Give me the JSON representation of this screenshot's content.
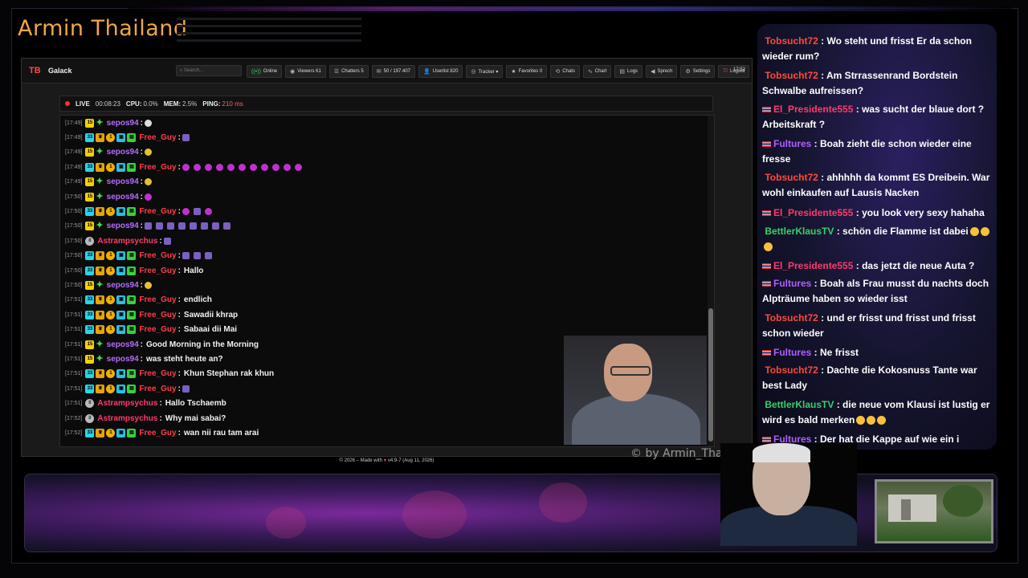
{
  "streamer_name": "Armin Thailand",
  "watermark": "© by Armin_Thailand",
  "app": {
    "logo": "TB",
    "name": "Galack",
    "search_placeholder": "Search...",
    "nav": [
      {
        "icon": "online-icon",
        "glyph": "((•))",
        "label": "Online",
        "cls": "online"
      },
      {
        "icon": "eye-icon",
        "glyph": "◉",
        "label": "Viewers  61"
      },
      {
        "icon": "chatters-icon",
        "glyph": "☰",
        "label": "Chatters  5"
      },
      {
        "icon": "message-icon",
        "glyph": "✉",
        "label": "50 / 197.407"
      },
      {
        "icon": "user-icon",
        "glyph": "👤",
        "label": "Userlist  820"
      },
      {
        "icon": "tracker-icon",
        "glyph": "◎",
        "label": "Tracker ▾"
      },
      {
        "icon": "star-icon",
        "glyph": "★",
        "label": "Favorites  0"
      },
      {
        "icon": "chats-icon",
        "glyph": "⟲",
        "label": "Chats"
      },
      {
        "icon": "chart-icon",
        "glyph": "∿",
        "label": "Chart"
      },
      {
        "icon": "logs-icon",
        "glyph": "▤",
        "label": "Logs"
      },
      {
        "icon": "speech-icon",
        "glyph": "◀",
        "label": "Sprech"
      },
      {
        "icon": "gear-icon",
        "glyph": "⚙",
        "label": "Settings"
      },
      {
        "icon": "logout-icon",
        "glyph": "⎋",
        "label": "Logout",
        "cls": "logout"
      }
    ],
    "clock": "17:52",
    "status": {
      "live_label": "LIVE",
      "live_time": "00:08:23",
      "cpu_label": "CPU:",
      "cpu_value": "0.0%",
      "mem_label": "MEM:",
      "mem_value": "2.5%",
      "ping_label": "PING:",
      "ping_value": "210 ms"
    },
    "footer_left": "© 2026 – Made with",
    "footer_right": "v4.9-7 (Aug 11, 2026)"
  },
  "chat_messages": [
    {
      "time": "[17:49]",
      "badges": [
        "15",
        "star"
      ],
      "user": "sepos94",
      "ucls": "u-sepos",
      "emotes": [
        "white"
      ],
      "text": ""
    },
    {
      "time": "[17:49]",
      "badges": [
        "33",
        "crown",
        "coin",
        "gift",
        "green"
      ],
      "user": "Free_Guy",
      "ucls": "u-free",
      "emotes": [
        "sq"
      ],
      "text": ""
    },
    {
      "time": "[17:49]",
      "badges": [
        "15",
        "star"
      ],
      "user": "sepos94",
      "ucls": "u-sepos",
      "emotes": [
        "yellow"
      ],
      "text": ""
    },
    {
      "time": "[17:49]",
      "badges": [
        "33",
        "crown",
        "coin",
        "gift",
        "green"
      ],
      "user": "Free_Guy",
      "ucls": "u-free",
      "emotes": [
        "e",
        "e",
        "e",
        "e",
        "e",
        "e",
        "e",
        "e",
        "e",
        "e",
        "e"
      ],
      "text": ""
    },
    {
      "time": "[17:49]",
      "badges": [
        "15",
        "star"
      ],
      "user": "sepos94",
      "ucls": "u-sepos",
      "emotes": [
        "yellow"
      ],
      "text": ""
    },
    {
      "time": "[17:50]",
      "badges": [
        "15",
        "star"
      ],
      "user": "sepos94",
      "ucls": "u-sepos",
      "emotes": [
        "e"
      ],
      "text": ""
    },
    {
      "time": "[17:50]",
      "badges": [
        "33",
        "crown",
        "coin",
        "gift",
        "green"
      ],
      "user": "Free_Guy",
      "ucls": "u-free",
      "emotes": [
        "e",
        "sq",
        "e"
      ],
      "text": ""
    },
    {
      "time": "[17:50]",
      "badges": [
        "15",
        "star"
      ],
      "user": "sepos94",
      "ucls": "u-sepos",
      "emotes": [
        "sq",
        "sq",
        "sq",
        "sq",
        "sq",
        "sq",
        "sq",
        "sq"
      ],
      "text": ""
    },
    {
      "time": "[17:50]",
      "badges": [
        "8"
      ],
      "user": "Astrampsychus",
      "ucls": "u-astra",
      "emotes": [
        "sq"
      ],
      "text": ""
    },
    {
      "time": "[17:50]",
      "badges": [
        "33",
        "crown",
        "coin",
        "gift",
        "green"
      ],
      "user": "Free_Guy",
      "ucls": "u-free",
      "emotes": [
        "sq",
        "sq",
        "sq"
      ],
      "text": ""
    },
    {
      "time": "[17:50]",
      "badges": [
        "33",
        "crown",
        "coin",
        "gift",
        "green"
      ],
      "user": "Free_Guy",
      "ucls": "u-free",
      "emotes": [],
      "text": "Hallo"
    },
    {
      "time": "[17:50]",
      "badges": [
        "15",
        "star"
      ],
      "user": "sepos94",
      "ucls": "u-sepos",
      "emotes": [
        "yellow"
      ],
      "text": ""
    },
    {
      "time": "[17:51]",
      "badges": [
        "33",
        "crown",
        "coin",
        "gift",
        "green"
      ],
      "user": "Free_Guy",
      "ucls": "u-free",
      "emotes": [],
      "text": "endlich"
    },
    {
      "time": "[17:51]",
      "badges": [
        "33",
        "crown",
        "coin",
        "gift",
        "green"
      ],
      "user": "Free_Guy",
      "ucls": "u-free",
      "emotes": [],
      "text": "Sawadii khrap"
    },
    {
      "time": "[17:51]",
      "badges": [
        "33",
        "crown",
        "coin",
        "gift",
        "green"
      ],
      "user": "Free_Guy",
      "ucls": "u-free",
      "emotes": [],
      "text": "Sabaai dii Mai"
    },
    {
      "time": "[17:51]",
      "badges": [
        "15",
        "star"
      ],
      "user": "sepos94",
      "ucls": "u-sepos",
      "emotes": [],
      "text": "Good Morning in the Morning"
    },
    {
      "time": "[17:51]",
      "badges": [
        "15",
        "star"
      ],
      "user": "sepos94",
      "ucls": "u-sepos",
      "emotes": [],
      "text": "was steht heute an?"
    },
    {
      "time": "[17:51]",
      "badges": [
        "33",
        "crown",
        "coin",
        "gift",
        "green"
      ],
      "user": "Free_Guy",
      "ucls": "u-free",
      "emotes": [],
      "text": "Khun Stephan rak khun"
    },
    {
      "time": "[17:51]",
      "badges": [
        "33",
        "crown",
        "coin",
        "gift",
        "green"
      ],
      "user": "Free_Guy",
      "ucls": "u-free",
      "emotes": [
        "sq"
      ],
      "text": ""
    },
    {
      "time": "[17:51]",
      "badges": [
        "8"
      ],
      "user": "Astrampsychus",
      "ucls": "u-astra",
      "emotes": [],
      "text": "Hallo Tschaemb"
    },
    {
      "time": "[17:52]",
      "badges": [
        "8"
      ],
      "user": "Astrampsychus",
      "ucls": "u-astra",
      "emotes": [],
      "text": "Why mai sabai?"
    },
    {
      "time": "[17:52]",
      "badges": [
        "33",
        "crown",
        "coin",
        "gift",
        "green"
      ],
      "user": "Free_Guy",
      "ucls": "u-free",
      "emotes": [],
      "text": "wan nii rau tam arai"
    }
  ],
  "side_chat": [
    {
      "user": "Tobsucht72",
      "cls": "c-tob",
      "flag": false,
      "text": "Wo steht und frisst Er da schon wieder rum?",
      "emojis": 0
    },
    {
      "user": "Tobsucht72",
      "cls": "c-tob",
      "flag": false,
      "text": "Am Strrassenrand Bordstein Schwalbe aufreissen?",
      "emojis": 0
    },
    {
      "user": "El_Presidente555",
      "cls": "c-el",
      "flag": true,
      "text": "was sucht der blaue dort ? Arbeitskraft ?",
      "emojis": 0
    },
    {
      "user": "Fultures",
      "cls": "c-ful",
      "flag": true,
      "text": "Boah zieht die schon wieder eine fresse",
      "emojis": 0
    },
    {
      "user": "Tobsucht72",
      "cls": "c-tob",
      "flag": false,
      "text": "ahhhhh da kommt ES Dreibein. War wohl einkaufen auf Lausis Nacken",
      "emojis": 0
    },
    {
      "user": "El_Presidente555",
      "cls": "c-el",
      "flag": true,
      "text": "you look very sexy hahaha",
      "emojis": 0
    },
    {
      "user": "BettlerKlausTV",
      "cls": "c-bet",
      "flag": false,
      "text": "schön die Flamme ist dabei",
      "emojis": 3
    },
    {
      "user": "El_Presidente555",
      "cls": "c-el",
      "flag": true,
      "text": "das jetzt die neue Auta ?",
      "emojis": 0
    },
    {
      "user": "Fultures",
      "cls": "c-ful",
      "flag": true,
      "text": "Boah als Frau musst du nachts doch Alpträume haben so wieder isst",
      "emojis": 0
    },
    {
      "user": "Tobsucht72",
      "cls": "c-tob",
      "flag": false,
      "text": "und er frisst und frisst und frisst schon wieder",
      "emojis": 0
    },
    {
      "user": "Fultures",
      "cls": "c-ful",
      "flag": true,
      "text": "Ne frisst",
      "emojis": 0
    },
    {
      "user": "Tobsucht72",
      "cls": "c-tob",
      "flag": false,
      "text": "Dachte die Kokosnuss Tante war best Lady",
      "emojis": 0
    },
    {
      "user": "BettlerKlausTV",
      "cls": "c-bet",
      "flag": false,
      "text": "die neue vom Klausi ist lustig er wird es bald merken",
      "emojis": 3
    },
    {
      "user": "Fultures",
      "cls": "c-ful",
      "flag": true,
      "text": "Der hat die Kappe auf wie ein i",
      "emojis": 0
    }
  ]
}
